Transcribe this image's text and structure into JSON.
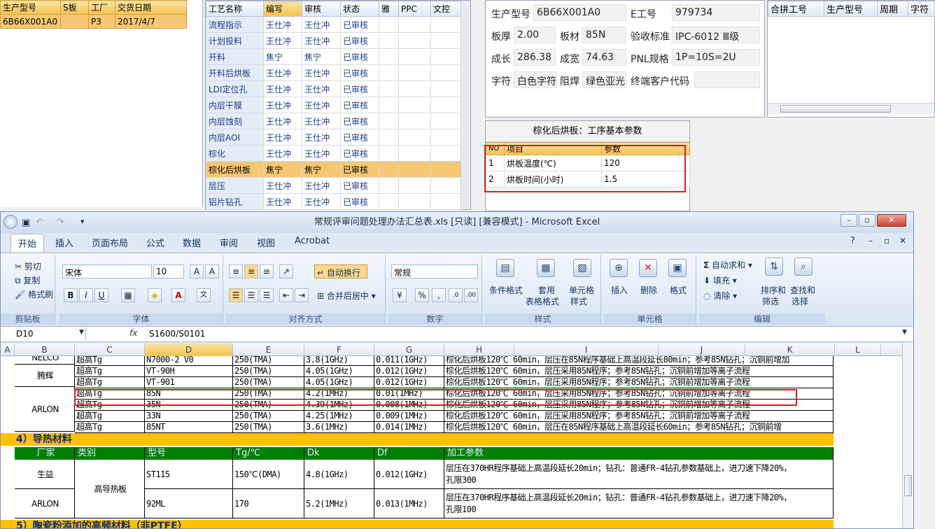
{
  "orders": {
    "headers": [
      "生产型号",
      "S板",
      "工厂",
      "交货日期"
    ],
    "rows": [
      [
        "6B66X001A0",
        "",
        "P3",
        "2017/4/7"
      ]
    ]
  },
  "process": {
    "headers": [
      "工艺名称",
      "编写",
      "审核",
      "状态",
      "雅",
      "PPC",
      "文控"
    ],
    "rows": [
      [
        "流程指示",
        "王仕冲",
        "王仕冲",
        "已审核"
      ],
      [
        "计划投料",
        "王仕冲",
        "王仕冲",
        "已审核"
      ],
      [
        "开料",
        "焦宁",
        "焦宁",
        "已审核"
      ],
      [
        "开料后烘板",
        "王仕冲",
        "王仕冲",
        "已审核"
      ],
      [
        "LDI定位孔",
        "王仕冲",
        "王仕冲",
        "已审核"
      ],
      [
        "内层干膜",
        "王仕冲",
        "王仕冲",
        "已审核"
      ],
      [
        "内层蚀刻",
        "王仕冲",
        "王仕冲",
        "已审核"
      ],
      [
        "内层AOI",
        "王仕冲",
        "王仕冲",
        "已审核"
      ],
      [
        "棕化",
        "王仕冲",
        "王仕冲",
        "已审核"
      ],
      [
        "棕化后烘板",
        "焦宁",
        "焦宁",
        "已审核"
      ],
      [
        "层压",
        "王仕冲",
        "王仕冲",
        "已审核"
      ],
      [
        "铝片钻孔",
        "王仕冲",
        "王仕冲",
        "已审核"
      ]
    ]
  },
  "info": {
    "model_label": "生产型号",
    "model_value": "6B66X001A0",
    "eno_label": "E工号",
    "eno_value": "979734",
    "thick_label": "板厚",
    "thick_value": "2.00",
    "mat_label": "板材",
    "mat_value": "85N",
    "std_label": "验收标准",
    "std_value": "IPC-6012 Ⅲ级",
    "len_label": "成长",
    "len_value": "286.38",
    "wid_label": "成宽",
    "wid_value": "74.63",
    "pnl_label": "PNL规格",
    "pnl_value": "1P=10S=2U",
    "char_label": "字符",
    "char_value": "白色字符",
    "mask_label": "阻焊",
    "mask_value": "绿色亚光",
    "cust_label": "终端客户代码",
    "cust_value": ""
  },
  "merge": {
    "headers": [
      "合拼工号",
      "生产型号",
      "周期",
      "字符"
    ]
  },
  "params": {
    "caption": "棕化后烘板：工序基本参数",
    "headers": [
      "NO",
      "项目",
      "参数"
    ],
    "rows": [
      [
        "1",
        "烘板温度(℃)",
        "120"
      ],
      [
        "2",
        "烘板时间(小时)",
        "1.5"
      ]
    ]
  },
  "excel": {
    "title": "常规评审问题处理办法汇总表.xls  [只读]  [兼容模式] - Microsoft Excel",
    "tabs": [
      "开始",
      "插入",
      "页面布局",
      "公式",
      "数据",
      "审阅",
      "视图",
      "Acrobat"
    ],
    "clipboard": {
      "cut": "剪切",
      "copy": "复制",
      "painter": "格式刷",
      "label": "剪贴板"
    },
    "font": {
      "name": "宋体",
      "size": "10",
      "label": "字体"
    },
    "align": {
      "wrap": "自动换行",
      "merge": "合并后居中",
      "label": "对齐方式"
    },
    "number": {
      "format": "常规",
      "label": "数字"
    },
    "styles": {
      "cond": "条件格式",
      "table1": "套用",
      "table2": "表格格式",
      "cell1": "单元格",
      "cell2": "样式",
      "label": "样式"
    },
    "cells": {
      "insert": "插入",
      "delete": "删除",
      "format": "格式",
      "label": "单元格"
    },
    "edit": {
      "autosum": "自动求和",
      "fill": "填充",
      "clear": "清除",
      "sort1": "排序和",
      "sort2": "筛选",
      "find1": "查找和",
      "find2": "选择",
      "label": "编辑"
    },
    "namebox": "D10",
    "fx": "fx",
    "formula": "S1600/S0101",
    "columns": [
      "A",
      "B",
      "C",
      "D",
      "E",
      "F",
      "G",
      "H",
      "I",
      "J",
      "K",
      "L"
    ],
    "rows": [
      {
        "c": "超高Tg",
        "d": "N7000-2 V0",
        "e": "250(TMA)",
        "f": "3.8(1GHz)",
        "g": "0.011(1GHz)",
        "h": "棕化后烘板120℃ 60min，层压在85N程序基础上高温段延长80min；参考85N钻孔；沉铜前增加"
      },
      {
        "c": "超高Tg",
        "d": "VT-90H",
        "e": "250(TMA)",
        "f": "4.05(1GHz)",
        "g": "0.012(1GHz)",
        "h": "棕化后烘板120℃ 60min，层压采用85N程序；参考85N钻孔；沉铜前增加等离子流程"
      },
      {
        "c": "超高Tg",
        "d": "VT-901",
        "e": "250(TMA)",
        "f": "4.05(1GHz)",
        "g": "0.012(1GHz)",
        "h": "棕化后烘板120℃ 60min，层压采用85N程序；参考85N钻孔；沉铜前增加等离子流程"
      },
      {
        "c": "超高Tg",
        "d": "85N",
        "e": "250(TMA)",
        "f": "4.2(1MHz)",
        "g": "0.01(1MHz)",
        "h": "棕化后烘板120℃ 60min，层压采用85N程序；参考85N钻孔；沉铜前增加等离子流程"
      },
      {
        "c": "超高Tg",
        "d": "35N",
        "e": "250(TMA)",
        "f": "4.39(1MHz)",
        "g": "0.008(1MHz)",
        "h": "棕化后烘板120℃ 60min，层压采用85N程序；参考85N钻孔；沉铜前增加等离子流程"
      },
      {
        "c": "超高Tg",
        "d": "33N",
        "e": "250(TMA)",
        "f": "4.25(1MHz)",
        "g": "0.009(1MHz)",
        "h": "棕化后烘板120℃ 60min，层压采用85N程序；参考85N钻孔；沉铜前增加等离子流程"
      },
      {
        "c": "超高Tg",
        "d": "85NT",
        "e": "250(TMA)",
        "f": "3.6(1MHz)",
        "g": "0.014(1MHz)",
        "h": "棕化后烘板120℃ 60min，层压在85N程序基础上高温段延长60min；参考85N钻孔；沉铜前增"
      }
    ],
    "vendor_top": "NELCO",
    "vendor_mid": "腾辉",
    "vendor_arlon": "ARLON",
    "section4": "4）导热材料",
    "section4_headers": [
      "厂家",
      "类别",
      "型号",
      "Tg/℃",
      "Dk",
      "Df",
      "加工参数"
    ],
    "section4_rows": [
      {
        "vendor": "生益",
        "model": "ST115",
        "tg": "150℃(DMA)",
        "dk": "4.8(1GHz)",
        "df": "0.012(1GHz)",
        "p1": "层压在370HR程序基础上高温段延长20min；钻孔：普通FR-4钻孔参数基础上，进刀速下降20%，",
        "p2": "孔限300"
      },
      {
        "vendor": "ARLON",
        "model": "92ML",
        "tg": "170",
        "dk": "5.2(1MHz)",
        "df": "0.013(1MHz)",
        "p1": "层压在370HR程序基础上高温段延长20min；钻孔：普通FR-4钻孔参数基础上，进刀速下降20%，",
        "p2": "孔限100"
      }
    ],
    "category": "高导热板",
    "section5": "5）陶瓷粉添加的高频材料（非PTFE）"
  }
}
